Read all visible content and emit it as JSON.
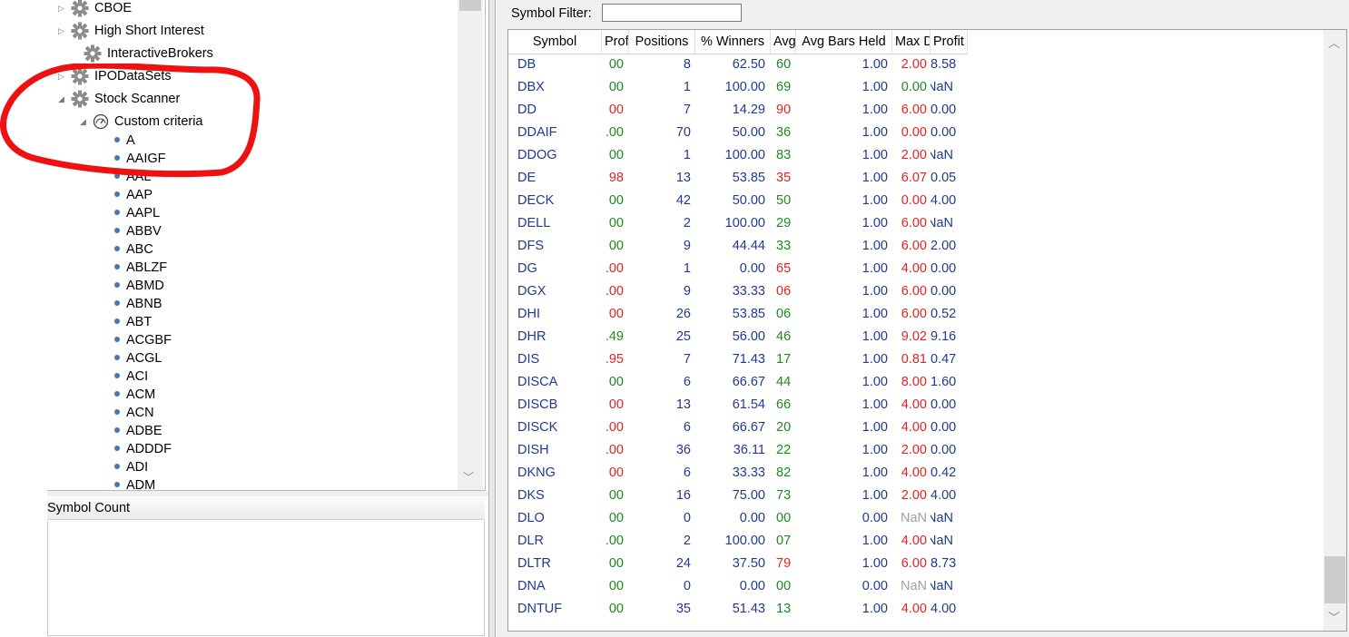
{
  "tree": {
    "nodes": [
      {
        "label": "CBOE",
        "expander": "▷",
        "icon": "gear"
      },
      {
        "label": "High Short Interest",
        "expander": "▷",
        "icon": "gear"
      },
      {
        "label": "InteractiveBrokers",
        "expander": "",
        "icon": "gear"
      },
      {
        "label": "IPODataSets",
        "expander": "▷",
        "icon": "gear"
      },
      {
        "label": "Stock Scanner",
        "expander": "◢",
        "icon": "gear"
      },
      {
        "label": "Custom criteria",
        "expander": "◢",
        "icon": "gauge"
      }
    ],
    "leaves": [
      "A",
      "AAIGF",
      "AAL",
      "AAP",
      "AAPL",
      "ABBV",
      "ABC",
      "ABLZF",
      "ABMD",
      "ABNB",
      "ABT",
      "ACGBF",
      "ACGL",
      "ACI",
      "ACM",
      "ACN",
      "ADBE",
      "ADDDF",
      "ADI",
      "ADM"
    ]
  },
  "symbol_count": {
    "header": "Symbol Count"
  },
  "filter": {
    "label": "Symbol Filter:",
    "value": ""
  },
  "grid": {
    "columns": [
      "Symbol",
      "Profit",
      "Positions",
      "% Winners",
      "Avg",
      "Avg Bars Held",
      "Max D",
      "Profit"
    ],
    "rows": [
      [
        "DB",
        "00",
        "8",
        "62.50",
        "60",
        "1.00",
        "2.00",
        "8.58"
      ],
      [
        "DBX",
        "00",
        "1",
        "100.00",
        "69",
        "1.00",
        "0.00",
        "NaN"
      ],
      [
        "DD",
        "00",
        "7",
        "14.29",
        "90",
        "1.00",
        "6.00",
        "0.00"
      ],
      [
        "DDAIF",
        ".00",
        "70",
        "50.00",
        "36",
        "1.00",
        "0.00",
        "0.00"
      ],
      [
        "DDOG",
        "00",
        "1",
        "100.00",
        "83",
        "1.00",
        "2.00",
        "NaN"
      ],
      [
        "DE",
        "98",
        "13",
        "53.85",
        "35",
        "1.00",
        "6.07",
        "0.05"
      ],
      [
        "DECK",
        "00",
        "42",
        "50.00",
        "50",
        "1.00",
        "0.00",
        "4.00"
      ],
      [
        "DELL",
        "00",
        "2",
        "100.00",
        "29",
        "1.00",
        "6.00",
        "NaN"
      ],
      [
        "DFS",
        "00",
        "9",
        "44.44",
        "33",
        "1.00",
        "6.00",
        "2.00"
      ],
      [
        "DG",
        ".00",
        "1",
        "0.00",
        "65",
        "1.00",
        "4.00",
        "0.00"
      ],
      [
        "DGX",
        ".00",
        "9",
        "33.33",
        "06",
        "1.00",
        "6.00",
        "0.00"
      ],
      [
        "DHI",
        "00",
        "26",
        "53.85",
        "06",
        "1.00",
        "6.00",
        "0.52"
      ],
      [
        "DHR",
        ".49",
        "25",
        "56.00",
        "46",
        "1.00",
        "9.02",
        "9.16"
      ],
      [
        "DIS",
        ".95",
        "7",
        "71.43",
        "17",
        "1.00",
        "0.81",
        "0.47"
      ],
      [
        "DISCA",
        "00",
        "6",
        "66.67",
        "44",
        "1.00",
        "8.00",
        "1.60"
      ],
      [
        "DISCB",
        "00",
        "13",
        "61.54",
        "66",
        "1.00",
        "4.00",
        "0.00"
      ],
      [
        "DISCK",
        ".00",
        "6",
        "66.67",
        "20",
        "1.00",
        "4.00",
        "0.00"
      ],
      [
        "DISH",
        ".00",
        "36",
        "36.11",
        "22",
        "1.00",
        "2.00",
        "0.00"
      ],
      [
        "DKNG",
        "00",
        "6",
        "33.33",
        "82",
        "1.00",
        "4.00",
        "0.42"
      ],
      [
        "DKS",
        "00",
        "16",
        "75.00",
        "73",
        "1.00",
        "2.00",
        "4.00"
      ],
      [
        "DLO",
        "00",
        "0",
        "0.00",
        "00",
        "0.00",
        "NaN",
        "NaN"
      ],
      [
        "DLR",
        ".00",
        "2",
        "100.00",
        "07",
        "1.00",
        "4.00",
        "NaN"
      ],
      [
        "DLTR",
        "00",
        "24",
        "37.50",
        "79",
        "1.00",
        "6.00",
        "8.73"
      ],
      [
        "DNA",
        "00",
        "0",
        "0.00",
        "00",
        "0.00",
        "NaN",
        "NaN"
      ],
      [
        "DNTUF",
        "00",
        "35",
        "51.43",
        "13",
        "1.00",
        "4.00",
        "4.00"
      ]
    ],
    "colors": {
      "profit": [
        "green",
        "green",
        "red",
        "green",
        "green",
        "red",
        "green",
        "green",
        "green",
        "red",
        "red",
        "red",
        "green",
        "red",
        "green",
        "red",
        "red",
        "red",
        "red",
        "green",
        "green",
        "green",
        "green",
        "green",
        "green"
      ],
      "avg": [
        "green",
        "green",
        "red",
        "green",
        "green",
        "red",
        "green",
        "green",
        "green",
        "red",
        "red",
        "green",
        "green",
        "green",
        "green",
        "green",
        "green",
        "green",
        "green",
        "green",
        "green",
        "green",
        "red",
        "green",
        "green"
      ],
      "maxd": [
        "red",
        "green",
        "red",
        "red",
        "red",
        "red",
        "red",
        "red",
        "red",
        "red",
        "red",
        "red",
        "red",
        "red",
        "red",
        "red",
        "red",
        "red",
        "red",
        "red",
        "gray",
        "red",
        "red",
        "gray",
        "red"
      ],
      "last": [
        "navy",
        "navy",
        "navy",
        "navy",
        "navy",
        "navy",
        "navy",
        "navy",
        "navy",
        "navy",
        "navy",
        "navy",
        "navy",
        "navy",
        "navy",
        "navy",
        "navy",
        "navy",
        "navy",
        "navy",
        "navy",
        "navy",
        "navy",
        "navy",
        "navy"
      ]
    }
  },
  "annotation": {
    "color": "#ee1111"
  }
}
